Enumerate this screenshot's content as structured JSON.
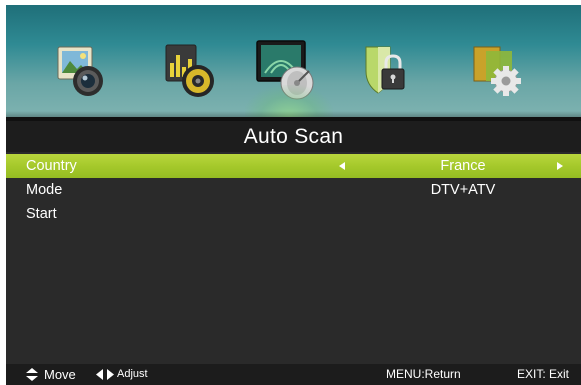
{
  "tabs": [
    {
      "icon": "picture-icon",
      "label": "Picture"
    },
    {
      "icon": "sound-icon",
      "label": "Sound"
    },
    {
      "icon": "channel-icon",
      "label": "Channel",
      "active": true
    },
    {
      "icon": "lock-icon",
      "label": "Lock"
    },
    {
      "icon": "setup-icon",
      "label": "Setup"
    }
  ],
  "page": {
    "title": "Auto Scan"
  },
  "menu": {
    "country": {
      "label": "Country",
      "value": "France",
      "selected": true
    },
    "mode": {
      "label": "Mode",
      "value": "DTV+ATV"
    },
    "start": {
      "label": "Start"
    }
  },
  "help": {
    "move": "Move",
    "adjust": "Adjust",
    "return": "MENU:Return",
    "exit": "EXIT: Exit"
  },
  "colors": {
    "selection": "#a5c92b",
    "background": "#2a2a2a",
    "header_top": "#1f6f79",
    "header_bottom": "#7fb3b1"
  }
}
